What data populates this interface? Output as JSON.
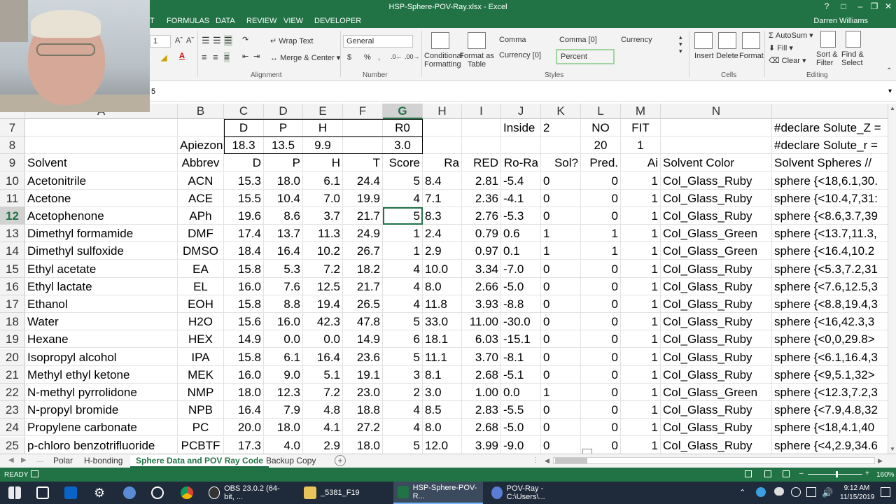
{
  "window": {
    "title": "HSP-Sphere-POV-Ray.xlsx - Excel",
    "user": "Darren Williams",
    "help": "?",
    "controls": [
      "□",
      "–",
      "❐",
      "✕"
    ]
  },
  "ribbon_tabs": [
    "T",
    "FORMULAS",
    "DATA",
    "REVIEW",
    "VIEW",
    "DEVELOPER"
  ],
  "ribbon": {
    "font_size": "1",
    "wrap_text": "Wrap Text",
    "merge_center": "Merge & Center",
    "number_format": "General",
    "currency_symbol": "$",
    "percent_symbol": "%",
    "comma_symbol": ",",
    "cond_format": "Conditional Formatting",
    "format_table": "Format as Table",
    "styles": [
      "Comma",
      "Comma [0]",
      "Currency",
      "Currency [0]",
      "Percent"
    ],
    "insert": "Insert",
    "delete": "Delete",
    "format": "Format",
    "autosum": "AutoSum",
    "fill": "Fill",
    "clear": "Clear",
    "sort_filter": "Sort & Filter",
    "find_select": "Find & Select",
    "groups": {
      "alignment": "Alignment",
      "number": "Number",
      "styles": "Styles",
      "cells": "Cells",
      "editing": "Editing"
    }
  },
  "formula_bar": {
    "value": "5"
  },
  "columns": [
    "A",
    "B",
    "C",
    "D",
    "E",
    "F",
    "G",
    "H",
    "I",
    "J",
    "K",
    "L",
    "M",
    "N",
    ""
  ],
  "selected_column": "G",
  "header_rows": [
    {
      "num": "7",
      "cells": [
        "",
        "",
        "D",
        "P",
        "H",
        "",
        "R0",
        "",
        "",
        "Inside",
        "2",
        "NO",
        "FIT",
        "",
        "#declare Solute_Z ="
      ]
    },
    {
      "num": "8",
      "cells": [
        "",
        "Apiezon",
        "18.3",
        "13.5",
        "9.9",
        "",
        "3.0",
        "",
        "",
        "",
        "",
        "20",
        "1",
        "",
        "#declare Solute_r ="
      ]
    },
    {
      "num": "9",
      "cells": [
        "Solvent",
        "Abbrev",
        "D",
        "P",
        "H",
        "T",
        "Score",
        "Ra",
        "RED",
        "Ro-Ra",
        "Sol?",
        "Pred.",
        "Ai",
        "Solvent Color",
        "Solvent Spheres // "
      ]
    }
  ],
  "rows": [
    {
      "num": "10",
      "cells": [
        "Acetonitrile",
        "ACN",
        "15.3",
        "18.0",
        "6.1",
        "24.4",
        "5",
        "8.4",
        "2.81",
        "-5.4",
        "0",
        "0",
        "1",
        "Col_Glass_Ruby",
        "sphere {<18,6.1,30."
      ]
    },
    {
      "num": "11",
      "cells": [
        "Acetone",
        "ACE",
        "15.5",
        "10.4",
        "7.0",
        "19.9",
        "4",
        "7.1",
        "2.36",
        "-4.1",
        "0",
        "0",
        "1",
        "Col_Glass_Ruby",
        "sphere {<10.4,7,31:"
      ]
    },
    {
      "num": "12",
      "cells": [
        "Acetophenone",
        "APh",
        "19.6",
        "8.6",
        "3.7",
        "21.7",
        "5",
        "8.3",
        "2.76",
        "-5.3",
        "0",
        "0",
        "1",
        "Col_Glass_Ruby",
        "sphere {<8.6,3.7,39"
      ]
    },
    {
      "num": "13",
      "cells": [
        "Dimethyl formamide",
        "DMF",
        "17.4",
        "13.7",
        "11.3",
        "24.9",
        "1",
        "2.4",
        "0.79",
        "0.6",
        "1",
        "1",
        "1",
        "Col_Glass_Green",
        "sphere {<13.7,11.3,"
      ]
    },
    {
      "num": "14",
      "cells": [
        "Dimethyl sulfoxide",
        "DMSO",
        "18.4",
        "16.4",
        "10.2",
        "26.7",
        "1",
        "2.9",
        "0.97",
        "0.1",
        "1",
        "1",
        "1",
        "Col_Glass_Green",
        "sphere {<16.4,10.2"
      ]
    },
    {
      "num": "15",
      "cells": [
        "Ethyl acetate",
        "EA",
        "15.8",
        "5.3",
        "7.2",
        "18.2",
        "4",
        "10.0",
        "3.34",
        "-7.0",
        "0",
        "0",
        "1",
        "Col_Glass_Ruby",
        "sphere {<5.3,7.2,31"
      ]
    },
    {
      "num": "16",
      "cells": [
        "Ethyl lactate",
        "EL",
        "16.0",
        "7.6",
        "12.5",
        "21.7",
        "4",
        "8.0",
        "2.66",
        "-5.0",
        "0",
        "0",
        "1",
        "Col_Glass_Ruby",
        "sphere {<7.6,12.5,3"
      ]
    },
    {
      "num": "17",
      "cells": [
        "Ethanol",
        "EOH",
        "15.8",
        "8.8",
        "19.4",
        "26.5",
        "4",
        "11.8",
        "3.93",
        "-8.8",
        "0",
        "0",
        "1",
        "Col_Glass_Ruby",
        "sphere {<8.8,19.4,3"
      ]
    },
    {
      "num": "18",
      "cells": [
        "Water",
        "H2O",
        "15.6",
        "16.0",
        "42.3",
        "47.8",
        "5",
        "33.0",
        "11.00",
        "-30.0",
        "0",
        "0",
        "1",
        "Col_Glass_Ruby",
        "sphere {<16,42.3,3"
      ]
    },
    {
      "num": "19",
      "cells": [
        "Hexane",
        "HEX",
        "14.9",
        "0.0",
        "0.0",
        "14.9",
        "6",
        "18.1",
        "6.03",
        "-15.1",
        "0",
        "0",
        "1",
        "Col_Glass_Ruby",
        "sphere {<0,0,29.8>"
      ]
    },
    {
      "num": "20",
      "cells": [
        "Isopropyl alcohol",
        "IPA",
        "15.8",
        "6.1",
        "16.4",
        "23.6",
        "5",
        "11.1",
        "3.70",
        "-8.1",
        "0",
        "0",
        "1",
        "Col_Glass_Ruby",
        "sphere {<6.1,16.4,3"
      ]
    },
    {
      "num": "21",
      "cells": [
        "Methyl ethyl ketone",
        "MEK",
        "16.0",
        "9.0",
        "5.1",
        "19.1",
        "3",
        "8.1",
        "2.68",
        "-5.1",
        "0",
        "0",
        "1",
        "Col_Glass_Ruby",
        "sphere {<9,5.1,32>"
      ]
    },
    {
      "num": "22",
      "cells": [
        "N-methyl pyrrolidone",
        "NMP",
        "18.0",
        "12.3",
        "7.2",
        "23.0",
        "2",
        "3.0",
        "1.00",
        "0.0",
        "1",
        "0",
        "1",
        "Col_Glass_Green",
        "sphere {<12.3,7.2,3"
      ]
    },
    {
      "num": "23",
      "cells": [
        "N-propyl bromide",
        "NPB",
        "16.4",
        "7.9",
        "4.8",
        "18.8",
        "4",
        "8.5",
        "2.83",
        "-5.5",
        "0",
        "0",
        "1",
        "Col_Glass_Ruby",
        "sphere {<7.9,4.8,32"
      ]
    },
    {
      "num": "24",
      "cells": [
        "Propylene carbonate",
        "PC",
        "20.0",
        "18.0",
        "4.1",
        "27.2",
        "4",
        "8.0",
        "2.68",
        "-5.0",
        "0",
        "0",
        "1",
        "Col_Glass_Ruby",
        "sphere {<18,4.1,40"
      ]
    },
    {
      "num": "25",
      "cells": [
        "p-chloro benzotrifluoride",
        "PCBTF",
        "17.3",
        "4.0",
        "2.9",
        "18.0",
        "5",
        "12.0",
        "3.99",
        "-9.0",
        "0",
        "0",
        "1",
        "Col_Glass_Ruby",
        "sphere {<4,2.9,34.6"
      ]
    }
  ],
  "selected_row": "12",
  "sheet_tabs": [
    "Polar",
    "H-bonding",
    "Sphere Data and POV Ray Code",
    "Backup Copy"
  ],
  "active_sheet": "Sphere Data and POV Ray Code",
  "status": {
    "ready": "READY",
    "zoom": "160%"
  },
  "taskbar": {
    "items": [
      "OBS 23.0.2 (64-bit, ...",
      "_5381_F19",
      "HSP-Sphere-POV-R...",
      "POV-Ray - C:\\Users\\..."
    ],
    "time": "9:12 AM",
    "date": "11/15/2019"
  },
  "colors": {
    "excel_green": "#217346",
    "taskbar": "#1f2b3a"
  }
}
